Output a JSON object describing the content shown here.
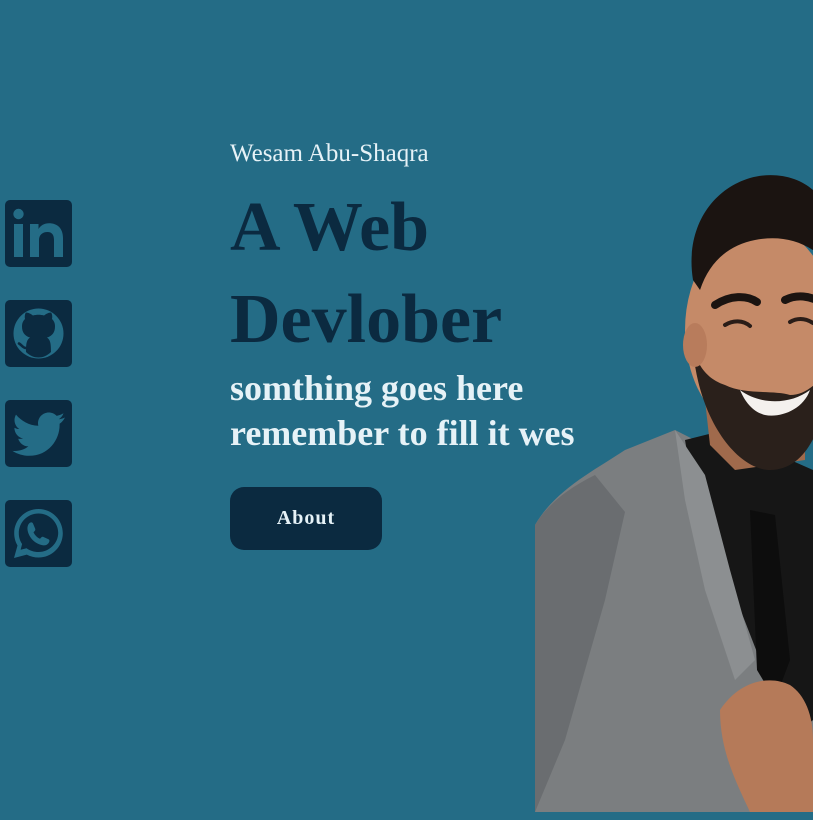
{
  "social": [
    {
      "name": "linkedin",
      "icon": "linkedin-icon"
    },
    {
      "name": "github",
      "icon": "github-icon"
    },
    {
      "name": "twitter",
      "icon": "twitter-icon"
    },
    {
      "name": "whatsapp",
      "icon": "whatsapp-icon"
    }
  ],
  "hero": {
    "author": "Wesam Abu-Shaqra",
    "headline": "A Web Devlober",
    "subtitle": "somthing goes here remember to fill it wes",
    "button_label": "About"
  },
  "colors": {
    "background": "#246c86",
    "dark": "#0b2a40",
    "light_text": "#e6f2f7"
  }
}
